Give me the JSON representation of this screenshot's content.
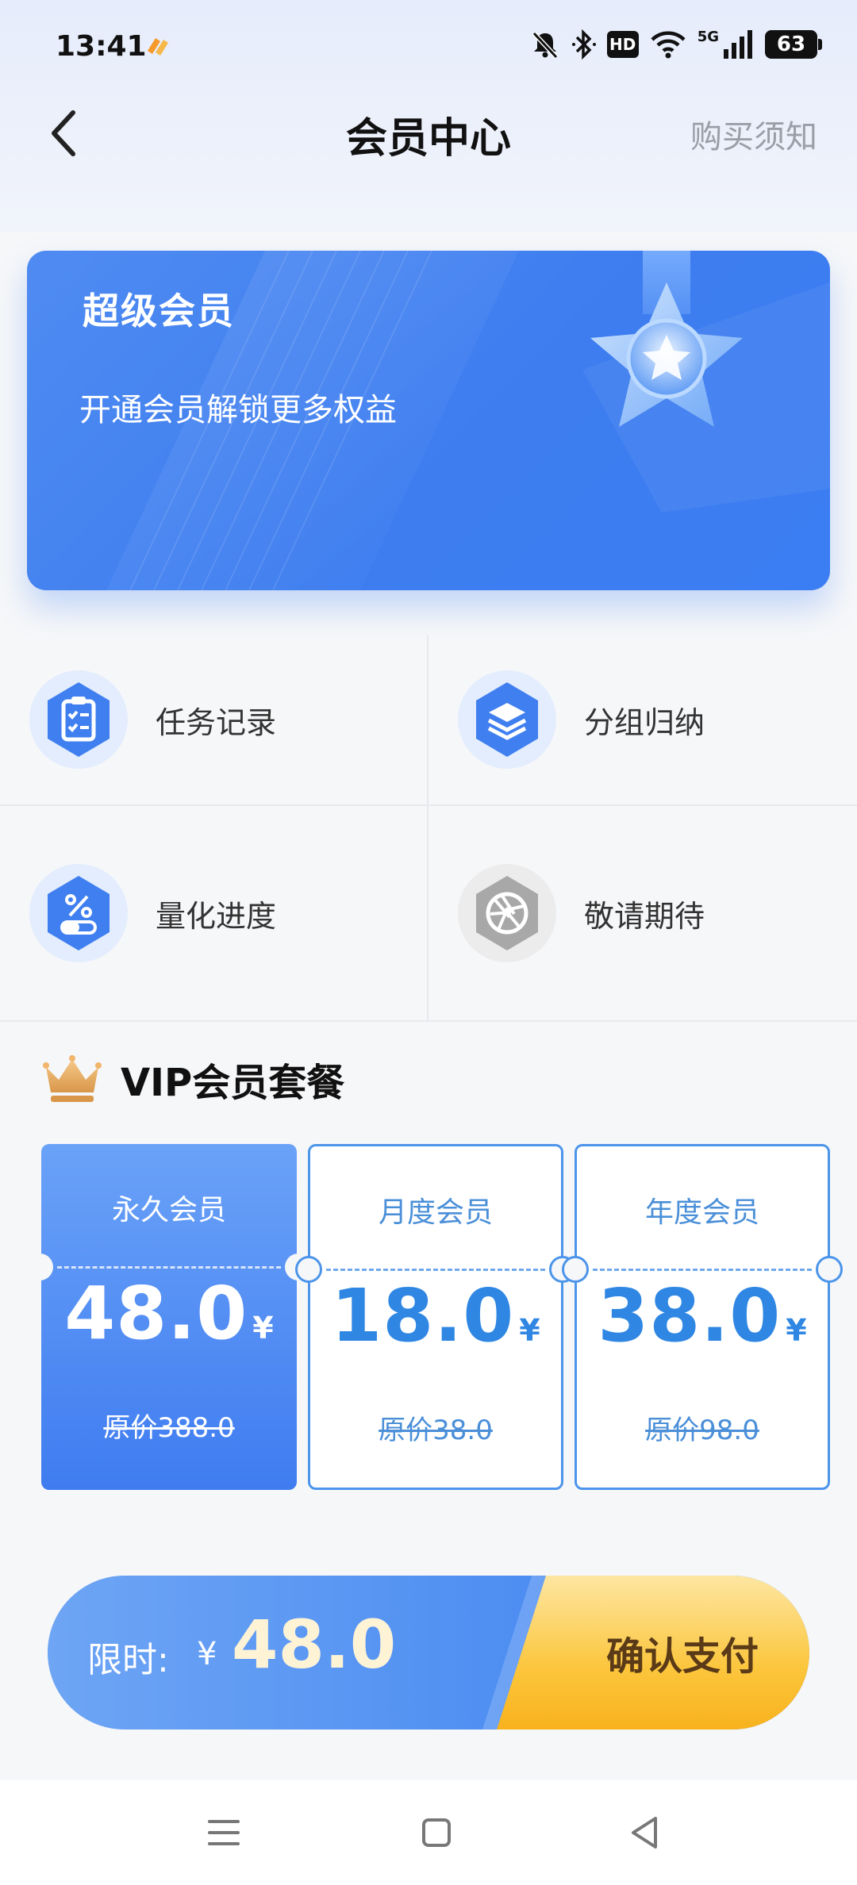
{
  "status_bar": {
    "time": "13:41",
    "network_label": "5G",
    "hd_label": "HD",
    "battery_level": "63"
  },
  "header": {
    "title": "会员中心",
    "buy_notice": "购买须知"
  },
  "banner": {
    "title": "超级会员",
    "subtitle": "开通会员解锁更多权益"
  },
  "features": [
    {
      "label": "任务记录",
      "icon": "task-list-icon"
    },
    {
      "label": "分组归纳",
      "icon": "layers-icon"
    },
    {
      "label": "量化进度",
      "icon": "percent-progress-icon"
    },
    {
      "label": "敬请期待",
      "icon": "aperture-icon"
    }
  ],
  "vip": {
    "title": "VIP会员套餐",
    "plans": [
      {
        "name": "永久会员",
        "price": "48.0",
        "currency": "¥",
        "original": "原价388.0",
        "selected": true
      },
      {
        "name": "月度会员",
        "price": "18.0",
        "currency": "¥",
        "original": "原价38.0",
        "selected": false
      },
      {
        "name": "年度会员",
        "price": "38.0",
        "currency": "¥",
        "original": "原价98.0",
        "selected": false
      }
    ]
  },
  "pay": {
    "label": "限时:",
    "currency": "¥",
    "amount": "48.0",
    "button": "确认支付"
  },
  "colors": {
    "accent_blue": "#3f7ff0",
    "plan_border": "#4c95ea",
    "pay_gold": "#fcc63d"
  }
}
